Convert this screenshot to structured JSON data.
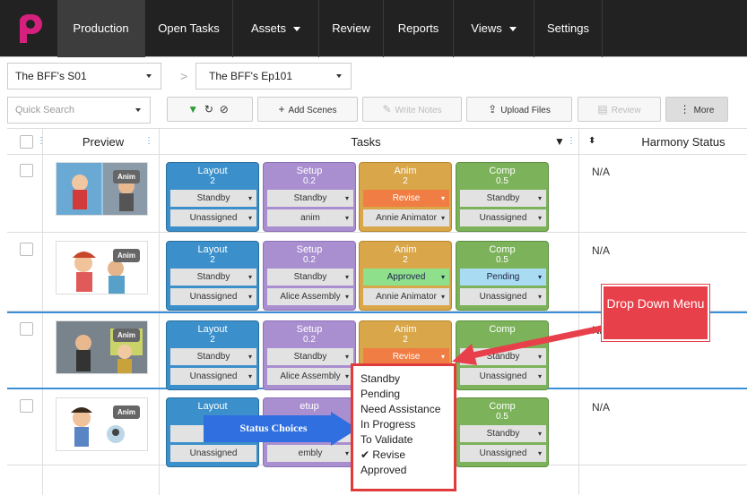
{
  "nav": {
    "items": [
      "Production",
      "Open Tasks",
      "Assets",
      "Review",
      "Reports",
      "Views",
      "Settings"
    ]
  },
  "selectors": {
    "season": "The BFF's S01",
    "episode": "The BFF's Ep101",
    "separator": ">"
  },
  "toolbar": {
    "search_placeholder": "Quick Search",
    "add_scenes": "Add Scenes",
    "write_notes": "Write Notes",
    "upload_files": "Upload Files",
    "review": "Review",
    "more": "More"
  },
  "grid": {
    "headers": {
      "preview": "Preview",
      "tasks": "Tasks",
      "harmony_status": "Harmony Status"
    },
    "rows": [
      {
        "badge": "Anim",
        "harmony": "N/A",
        "tasks": [
          {
            "name": "Layout",
            "version": "2",
            "status": "Standby",
            "assignee": "Unassigned"
          },
          {
            "name": "Setup",
            "version": "0.2",
            "status": "Standby",
            "assignee": "anim"
          },
          {
            "name": "Anim",
            "version": "2",
            "status": "Revise",
            "assignee": "Annie Animator"
          },
          {
            "name": "Comp",
            "version": "0.5",
            "status": "Standby",
            "assignee": "Unassigned"
          }
        ]
      },
      {
        "badge": "Anim",
        "harmony": "N/A",
        "tasks": [
          {
            "name": "Layout",
            "version": "2",
            "status": "Standby",
            "assignee": "Unassigned"
          },
          {
            "name": "Setup",
            "version": "0.2",
            "status": "Standby",
            "assignee": "Alice Assembly"
          },
          {
            "name": "Anim",
            "version": "2",
            "status": "Approved",
            "assignee": "Annie Animator"
          },
          {
            "name": "Comp",
            "version": "0.5",
            "status": "Pending",
            "assignee": "Unassigned"
          }
        ]
      },
      {
        "badge": "Anim",
        "harmony": "N/",
        "tasks": [
          {
            "name": "Layout",
            "version": "2",
            "status": "Standby",
            "assignee": "Unassigned"
          },
          {
            "name": "Setup",
            "version": "0.2",
            "status": "Standby",
            "assignee": "Alice Assembly"
          },
          {
            "name": "Anim",
            "version": "2",
            "status": "Revise",
            "assignee": ""
          },
          {
            "name": "Comp",
            "version": "",
            "status": "Standby",
            "assignee": "Unassigned"
          }
        ]
      },
      {
        "badge": "Anim",
        "harmony": "N/A",
        "tasks": [
          {
            "name": "Layout",
            "version": "",
            "status": "St",
            "assignee": "Unassigned"
          },
          {
            "name": "etup",
            "version": "",
            "status": "",
            "assignee": "embly"
          },
          {
            "name": "",
            "version": "",
            "status": "",
            "assignee": ""
          },
          {
            "name": "Comp",
            "version": "0.5",
            "status": "Standby",
            "assignee": "Unassigned"
          }
        ]
      }
    ]
  },
  "dropdown": {
    "options": [
      "Standby",
      "Pending",
      "Need Assistance",
      "In Progress",
      "To Validate",
      "✔ Revise",
      "Approved"
    ]
  },
  "annotations": {
    "callout": "Drop Down Menu",
    "status_arrow": "Status Choices"
  },
  "colors": {
    "layout": "#3b8fca",
    "setup": "#a98fd0",
    "anim": "#d9a74a",
    "comp": "#7cb35a",
    "revise": "#f07d43",
    "approved": "#8fe08a",
    "pending": "#a9dcf2",
    "annotation_red": "#e8404a",
    "annotation_blue": "#2f6fe0"
  }
}
